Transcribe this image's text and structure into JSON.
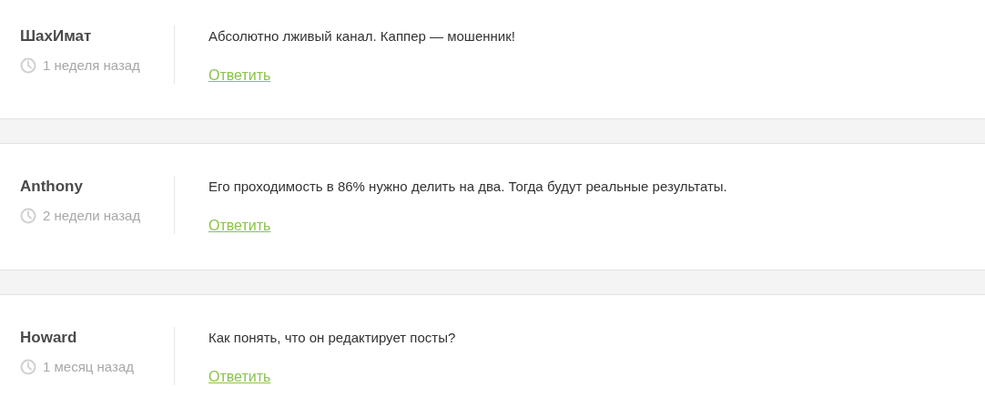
{
  "comments": [
    {
      "author": "ШахИмат",
      "time": "1 неделя назад",
      "text": "Абсолютно лживый канал. Каппер — мошенник!",
      "reply": "Ответить"
    },
    {
      "author": "Anthony",
      "time": "2 недели назад",
      "text": "Его проходимость в 86% нужно делить на два. Тогда будут реальные результаты.",
      "reply": "Ответить"
    },
    {
      "author": "Howard",
      "time": "1 месяц назад",
      "text": "Как понять, что он редактирует посты?",
      "reply": "Ответить"
    }
  ]
}
